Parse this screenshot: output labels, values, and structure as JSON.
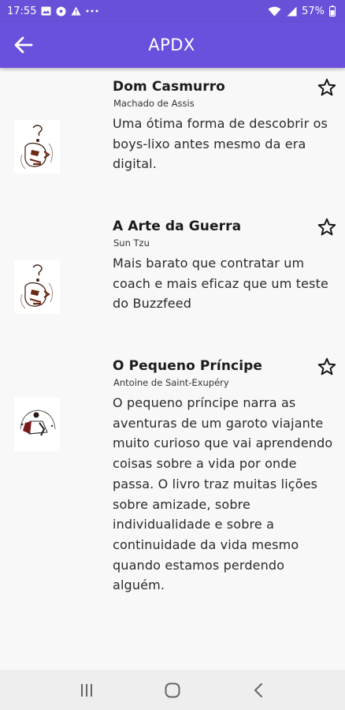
{
  "status_bar": {
    "time": "17:55",
    "battery": "57%",
    "icons": [
      "image-icon",
      "soccer-ball-icon",
      "warning-icon",
      "more-dots-icon",
      "wifi-icon",
      "signal-icon",
      "battery-icon"
    ]
  },
  "app_bar": {
    "title": "APDX",
    "back_icon": "arrow-left-icon"
  },
  "books": [
    {
      "title": "Dom Casmurro",
      "author": "Machado de Assis",
      "description": "Uma ótima forma de descobrir os boys-lixo antes mesmo da era digital.",
      "star_icon": "star-outline-icon"
    },
    {
      "title": "A Arte da Guerra",
      "author": "Sun Tzu",
      "description": "Mais barato que contratar um coach e mais eficaz que um teste do Buzzfeed",
      "star_icon": "star-outline-icon"
    },
    {
      "title": "O Pequeno Príncipe",
      "author": "Antoine de Saint-Exupéry",
      "description": "O pequeno príncipe narra as aventuras de um garoto viajante muito curioso que vai aprendendo coisas sobre a vida por onde passa. O livro traz muitas lições sobre amizade, sobre individualidade e sobre a continuidade da vida mesmo quando estamos perdendo alguém.",
      "star_icon": "star-outline-icon"
    }
  ],
  "nav_bar": {
    "buttons": [
      "recent-apps-icon",
      "home-icon",
      "back-chevron-icon"
    ]
  },
  "colors": {
    "primary": "#6b50dd",
    "background": "#f8f8f8",
    "text": "#1d1d1d"
  }
}
